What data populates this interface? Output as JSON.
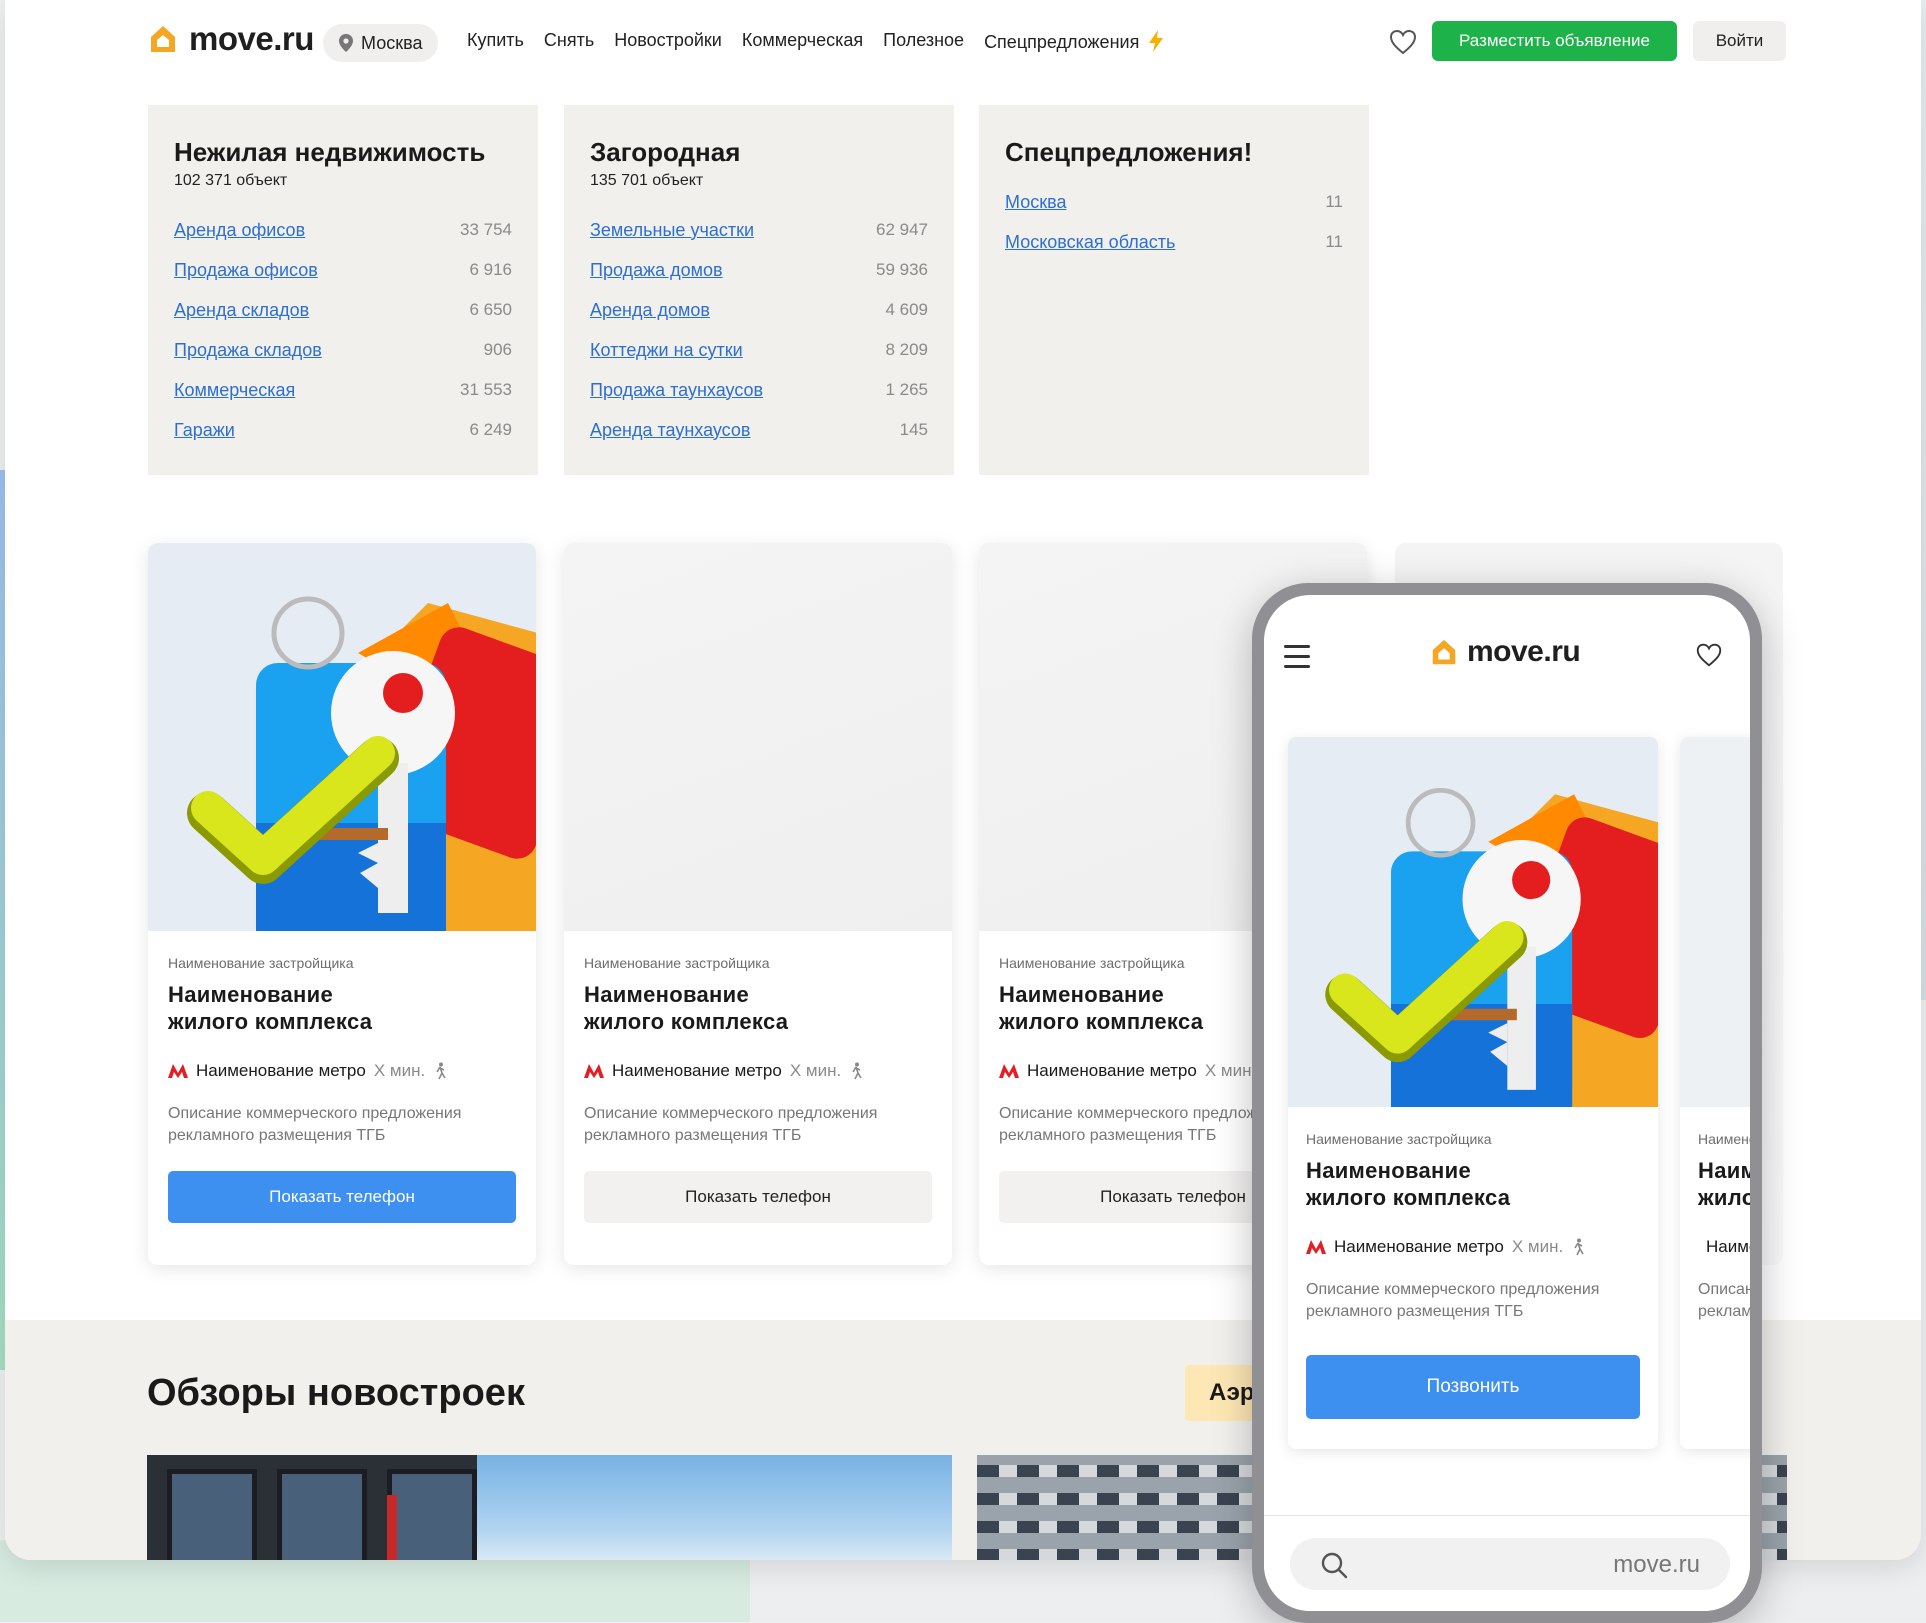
{
  "brand": {
    "name": "move.ru",
    "accent": "#f5a623",
    "green": "#1db24a",
    "blue": "#3d8ff0",
    "metro_red": "#e31e24"
  },
  "header": {
    "city": "Москва",
    "nav": [
      "Купить",
      "Снять",
      "Новостройки",
      "Коммерческая",
      "Полезное",
      "Спецпредложения"
    ],
    "special_icon": "lightning-icon",
    "post_button": "Разместить объявление",
    "login_button": "Войти"
  },
  "categories": [
    {
      "title": "Нежилая недвижимость",
      "count": "102 371 объект",
      "rows": [
        {
          "label": "Аренда офисов",
          "value": "33 754"
        },
        {
          "label": "Продажа офисов",
          "value": "6 916"
        },
        {
          "label": "Аренда складов",
          "value": "6 650"
        },
        {
          "label": "Продажа складов",
          "value": "906"
        },
        {
          "label": "Коммерческая",
          "value": "31 553"
        },
        {
          "label": "Гаражи",
          "value": "6 249"
        }
      ]
    },
    {
      "title": "Загородная",
      "count": "135 701 объект",
      "rows": [
        {
          "label": "Земельные участки",
          "value": "62 947"
        },
        {
          "label": "Продажа домов",
          "value": "59 936"
        },
        {
          "label": "Аренда домов",
          "value": "4 609"
        },
        {
          "label": "Коттеджи на сутки",
          "value": "8 209"
        },
        {
          "label": "Продажа таунхаусов",
          "value": "1 265"
        },
        {
          "label": "Аренда таунхаусов",
          "value": "145"
        }
      ]
    },
    {
      "title": "Спецпредложения!",
      "rows": [
        {
          "label": "Москва",
          "value": "11"
        },
        {
          "label": "Московская область",
          "value": "11"
        }
      ]
    }
  ],
  "listing": {
    "developer": "Наименование застройщика",
    "title_line1": "Наименование",
    "title_line2": "жилого комплекса",
    "metro": "Наименование метро",
    "time": "Х мин.",
    "desc_line1": "Описание коммерческого предложения",
    "desc_line2": "рекламного размещения ТГБ",
    "show_phone": "Показать телефон",
    "call": "Позвонить"
  },
  "reviews": {
    "title": "Обзоры новостроек",
    "chip": "Аэр"
  },
  "phone": {
    "url": "move.ru"
  }
}
